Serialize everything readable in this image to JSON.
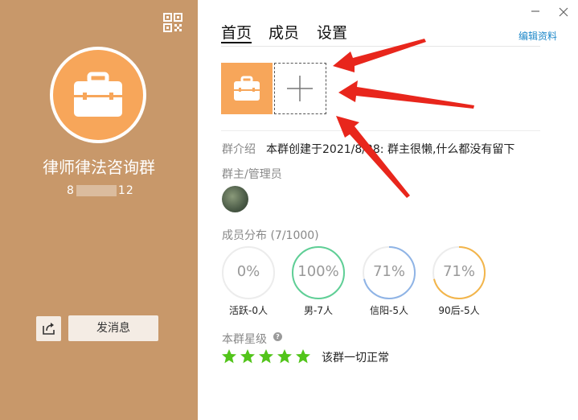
{
  "left_panel": {
    "group_name": "律师律法咨询群",
    "group_id_prefix": "8",
    "group_id_suffix": "12",
    "send_message_label": "发消息",
    "background_color": "#c8986a",
    "avatar_color": "#f7a65a",
    "avatar_icon": "briefcase-icon",
    "qr_icon": "qr-code-icon",
    "share_icon": "share-icon"
  },
  "window": {
    "minimize_icon": "minimize-icon",
    "close_icon": "close-icon"
  },
  "tabs": [
    {
      "label": "首页",
      "active": true
    },
    {
      "label": "成员",
      "active": false
    },
    {
      "label": "设置",
      "active": false
    }
  ],
  "edit_profile_label": "编辑资料",
  "edit_profile_color": "#1e88c9",
  "photos": {
    "add_icon": "plus-icon"
  },
  "intro": {
    "label": "群介绍",
    "text": "本群创建于2021/8/28:  群主很懒,什么都没有留下"
  },
  "admins": {
    "label": "群主/管理员"
  },
  "distribution": {
    "label": "成员分布 (7/1000)",
    "stats": [
      {
        "value": "0%",
        "fraction": 0,
        "caption": "活跃-0人",
        "color": "#dddddd"
      },
      {
        "value": "100%",
        "fraction": 1.0,
        "caption": "男-7人",
        "color": "#5fcf96"
      },
      {
        "value": "71%",
        "fraction": 0.71,
        "caption": "信阳-5人",
        "color": "#8fb4e6"
      },
      {
        "value": "71%",
        "fraction": 0.71,
        "caption": "90后-5人",
        "color": "#f3b54a"
      }
    ]
  },
  "rating": {
    "label": "本群星级",
    "stars": 5,
    "star_color": "#52c41a",
    "status": "该群一切正常"
  }
}
